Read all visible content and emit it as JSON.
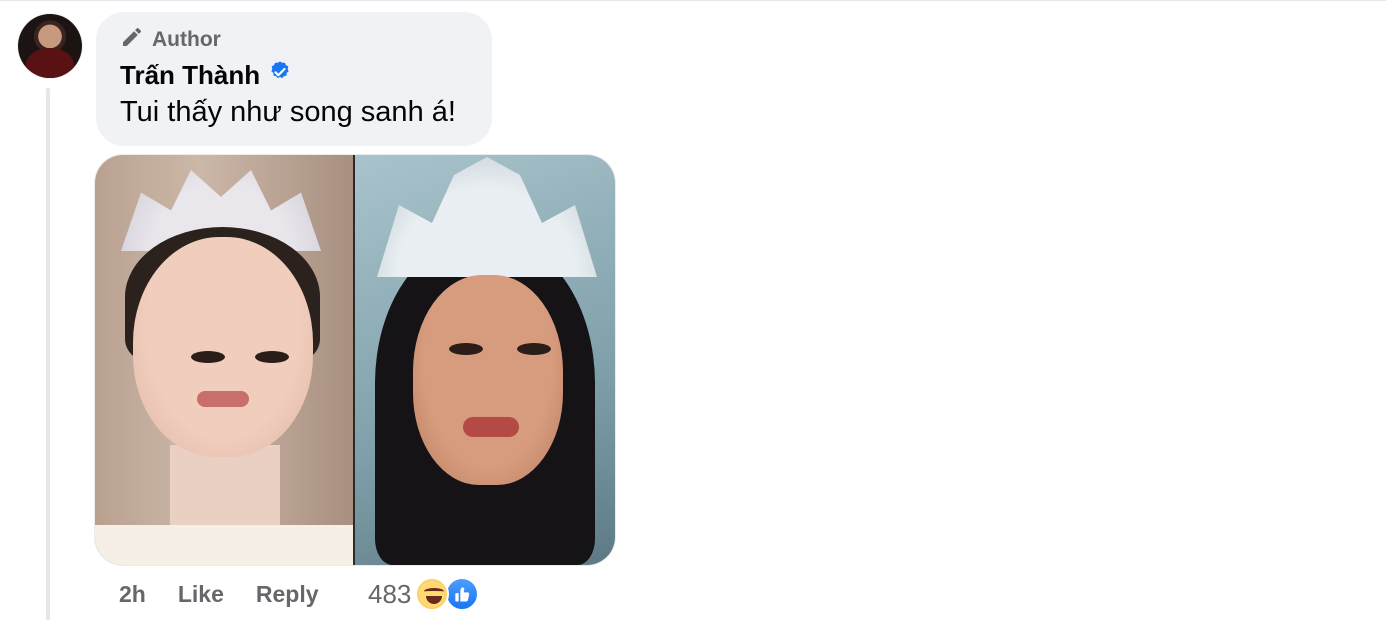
{
  "comment": {
    "author_badge": "Author",
    "author_name": "Trấn Thành",
    "text": "Tui thấy như song sanh á!",
    "timestamp": "2h",
    "actions": {
      "like": "Like",
      "reply": "Reply"
    },
    "reaction_count": "483",
    "reaction_icons": [
      "haha-icon",
      "like-icon"
    ],
    "colors": {
      "bubble": "#f0f2f5",
      "meta": "#65676b",
      "text": "#050505",
      "verified": "#1877f2"
    }
  }
}
